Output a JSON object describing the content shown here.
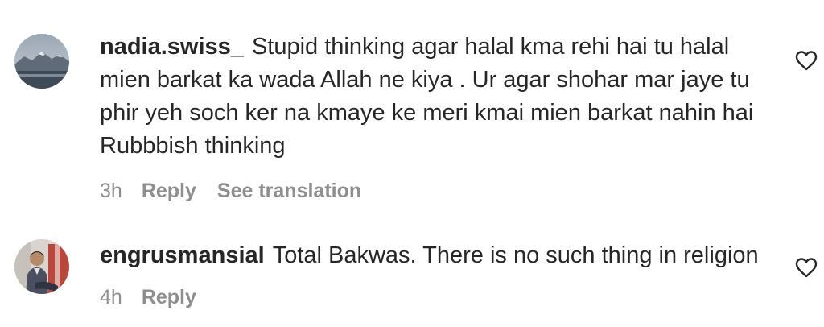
{
  "comments": [
    {
      "username": "nadia.swiss_",
      "text": "Stupid thinking agar halal kma rehi hai tu halal mien barkat ka wada Allah ne kiya . Ur agar shohar mar jaye tu phir yeh soch ker na kmaye ke meri kmai mien barkat nahin hai Rubbbish thinking",
      "time": "3h",
      "reply_label": "Reply",
      "translate_label": "See translation",
      "like_icon": "heart-outline-icon"
    },
    {
      "username": "engrusmansial",
      "text": "Total Bakwas. There is no such thing in religion",
      "time": "4h",
      "reply_label": "Reply",
      "like_icon": "heart-outline-icon"
    }
  ],
  "colors": {
    "text_primary": "#262626",
    "text_secondary": "#8e8e8e",
    "background": "#ffffff"
  }
}
